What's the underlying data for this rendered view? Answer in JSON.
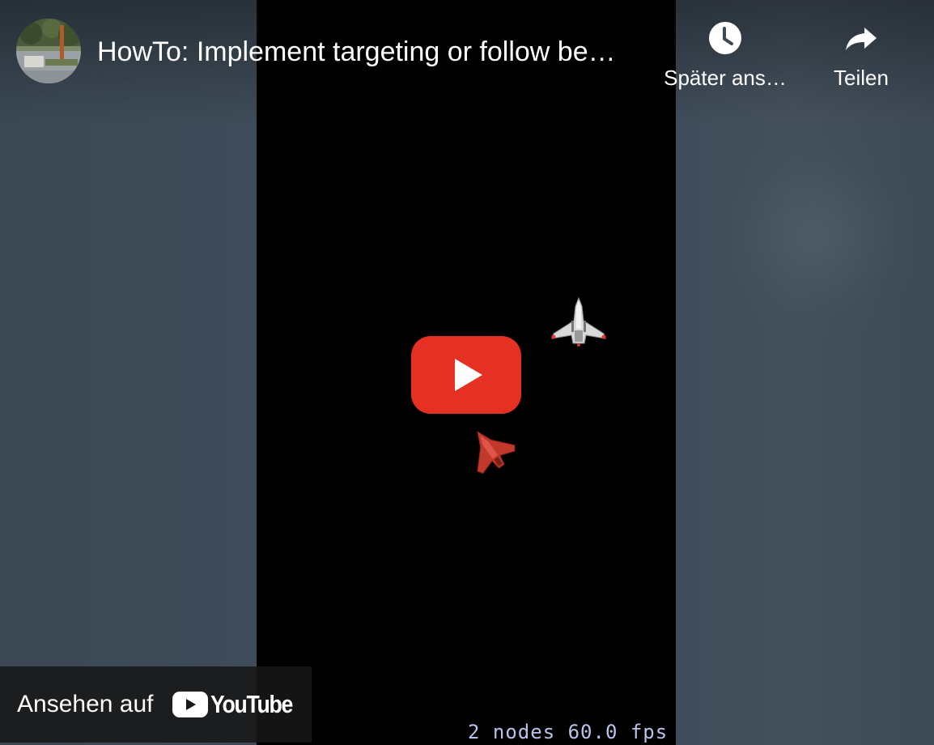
{
  "header": {
    "video_title": "HowTo: Implement targeting or follow be…",
    "channel_avatar_icon": "channel-avatar-photo"
  },
  "actions": {
    "watch_later": {
      "label": "Später ans…",
      "icon": "clock-icon"
    },
    "share": {
      "label": "Teilen",
      "icon": "share-arrow-icon"
    }
  },
  "player": {
    "play_icon": "youtube-play-icon",
    "play_color": "#e53024",
    "game_overlay": "2 nodes  60.0 fps"
  },
  "footer": {
    "watch_on_label": "Ansehen auf",
    "youtube_wordmark": "YouTube"
  }
}
